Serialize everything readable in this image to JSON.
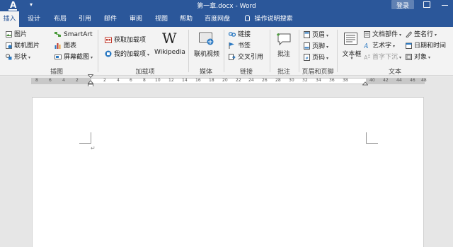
{
  "titlebar": {
    "app_letter": "A",
    "doc_title": "第一章.docx - Word",
    "login": "登录"
  },
  "tabs": [
    "插入",
    "设计",
    "布局",
    "引用",
    "邮件",
    "审阅",
    "视图",
    "帮助",
    "百度网盘"
  ],
  "tell_me": "操作说明搜索",
  "ribbon": {
    "illustrations": {
      "picture": "图片",
      "online_picture": "联机图片",
      "shapes": "形状",
      "smartart": "SmartArt",
      "chart": "图表",
      "screenshot": "屏幕截图",
      "label": "插图"
    },
    "addins": {
      "get_addins": "获取加载项",
      "my_addins": "我的加载项",
      "wikipedia": "Wikipedia",
      "label": "加载项"
    },
    "media": {
      "online_video": "联机视频",
      "label": "媒体"
    },
    "links": {
      "link": "链接",
      "bookmark": "书签",
      "cross_ref": "交叉引用",
      "label": "链接"
    },
    "comments": {
      "comment": "批注",
      "label": "批注"
    },
    "header_footer": {
      "header": "页眉",
      "footer": "页脚",
      "page_number": "页码",
      "label": "页眉和页脚"
    },
    "text": {
      "text_box": "文本框",
      "quick_parts": "文档部件",
      "wordart": "艺术字",
      "drop_cap": "首字下沉",
      "signature": "签名行",
      "date_time": "日期和时间",
      "object": "对象",
      "label": "文本"
    }
  },
  "ruler": {
    "left_ticks": [
      "8",
      "6",
      "4",
      "2"
    ],
    "right_ticks": [
      "2",
      "4",
      "6",
      "8",
      "10",
      "12",
      "14",
      "16",
      "18",
      "20",
      "22",
      "24",
      "26",
      "28",
      "30",
      "32",
      "34",
      "36",
      "38"
    ],
    "margin_ticks": [
      "40",
      "42",
      "44",
      "46",
      "48"
    ]
  },
  "document": {
    "paragraph_mark": "↵"
  },
  "colors": {
    "word_blue": "#2b579a",
    "ribbon_bg": "#f3f3f3",
    "canvas_bg": "#e6e6e6"
  }
}
